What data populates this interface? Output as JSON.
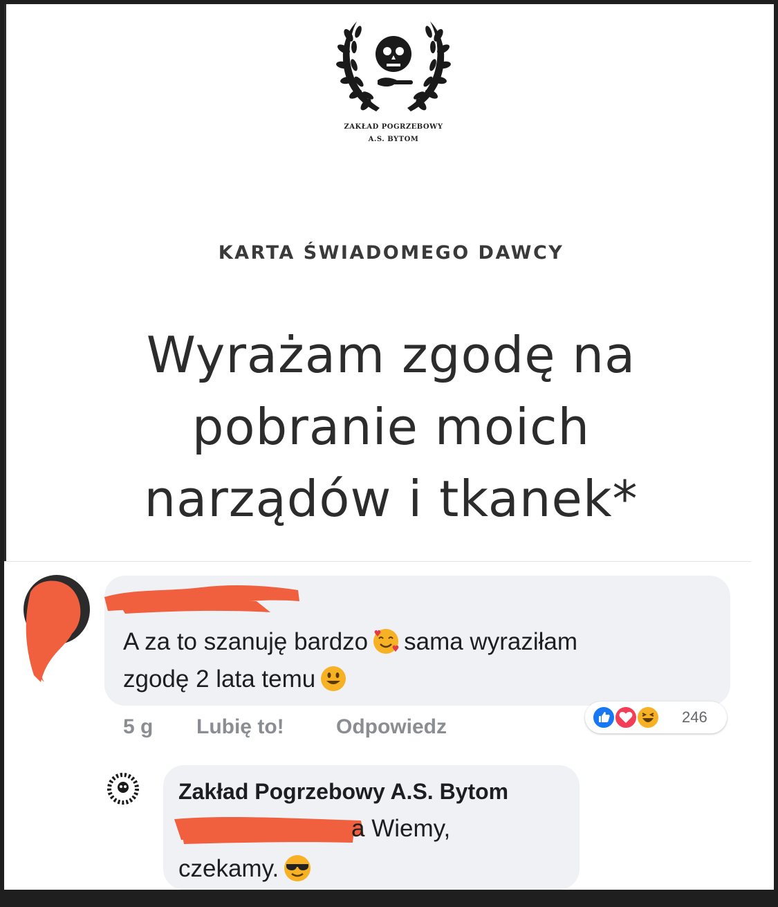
{
  "card": {
    "logo": {
      "icon": "skull-laurel-wreath-logo",
      "line1": "ZAKŁAD POGRZEBOWY",
      "line2": "A.S. BYTOM"
    },
    "subtitle": "KARTA ŚWIADOMEGO DAWCY",
    "headline": [
      "Wyrażam zgodę na",
      "pobranie moich",
      "narządów i tkanek*"
    ]
  },
  "comment": {
    "author": "",
    "text_line1_part1": "A za to szanuję bardzo",
    "emoji1": "smiling-face-with-hearts-emoji",
    "text_line1_part2": "sama wyraziłam",
    "text_line2": "zgodę 2 lata temu",
    "emoji2": "smiley-emoji",
    "time": "5 g",
    "like_label": "Lubię to!",
    "reply_label": "Odpowiedz",
    "reactions": [
      "like-reaction-icon",
      "love-reaction-icon",
      "haha-reaction-icon"
    ],
    "reaction_count": "246"
  },
  "reply": {
    "author": "Zakład Pogrzebowy A.S. Bytom",
    "text_end": "a Wiemy,",
    "text_line2": "czekamy.",
    "emoji": "sunglasses-emoji"
  },
  "colors": {
    "bubble": "#f0f1f4",
    "redaction": "#f0603f",
    "facebook_blue": "#1877f2",
    "love_red": "#f33e58",
    "haha_yellow": "#f7b125"
  }
}
